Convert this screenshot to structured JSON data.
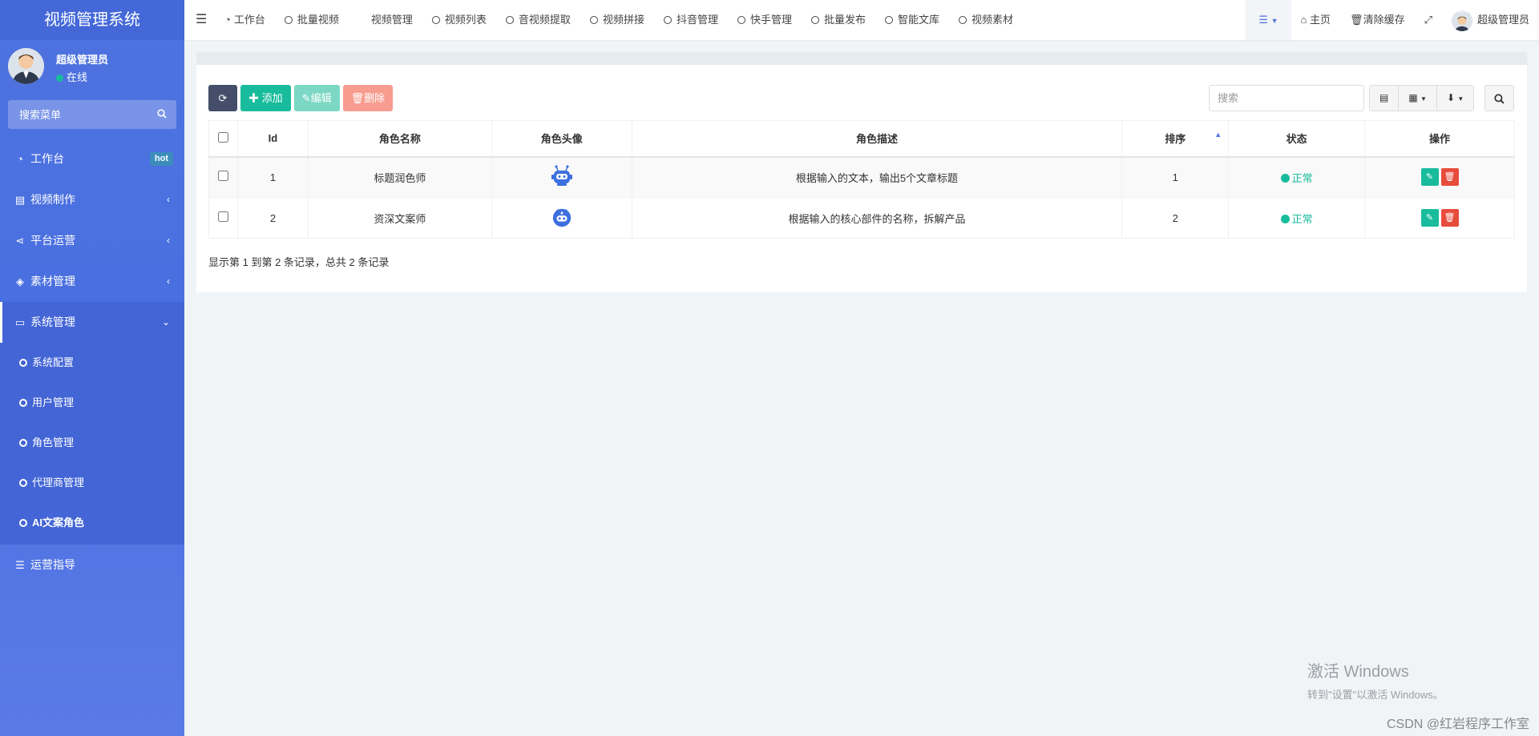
{
  "app": {
    "title": "视频管理系统"
  },
  "user": {
    "name": "超级管理员",
    "status": "在线"
  },
  "sidebar": {
    "search_placeholder": "搜索菜单",
    "items": [
      {
        "label": "工作台",
        "icon": "dashboard-icon",
        "badge": "hot"
      },
      {
        "label": "视频制作",
        "icon": "film-icon",
        "arrow": "‹"
      },
      {
        "label": "平台运营",
        "icon": "share-icon",
        "arrow": "‹"
      },
      {
        "label": "素材管理",
        "icon": "layers-icon",
        "arrow": "‹"
      },
      {
        "label": "系统管理",
        "icon": "desktop-icon",
        "arrow": "⌄"
      },
      {
        "label": "运营指导",
        "icon": "list-icon"
      }
    ],
    "sub_items": [
      {
        "label": "系统配置"
      },
      {
        "label": "用户管理"
      },
      {
        "label": "角色管理"
      },
      {
        "label": "代理商管理"
      },
      {
        "label": "AI文案角色"
      }
    ]
  },
  "navbar": {
    "tabs": [
      {
        "label": "工作台",
        "icon": "dashboard-icon"
      },
      {
        "label": "批量视频",
        "icon": "circle-icon"
      },
      {
        "label": "视频管理",
        "icon": ""
      },
      {
        "label": "视频列表",
        "icon": "circle-icon"
      },
      {
        "label": "音视频提取",
        "icon": "circle-icon"
      },
      {
        "label": "视频拼接",
        "icon": "circle-icon"
      },
      {
        "label": "抖音管理",
        "icon": "circle-icon"
      },
      {
        "label": "快手管理",
        "icon": "circle-icon"
      },
      {
        "label": "批量发布",
        "icon": "circle-icon"
      },
      {
        "label": "智能文库",
        "icon": "circle-icon"
      },
      {
        "label": "视频素材",
        "icon": "circle-icon"
      }
    ],
    "home": "主页",
    "clear_cache": "清除缓存",
    "user": "超级管理员"
  },
  "toolbar": {
    "add": "添加",
    "edit": "编辑",
    "delete": "删除",
    "search_placeholder": "搜索"
  },
  "table": {
    "columns": [
      "Id",
      "角色名称",
      "角色头像",
      "角色描述",
      "排序",
      "状态",
      "操作"
    ],
    "rows": [
      {
        "id": "1",
        "name": "标题润色师",
        "avatar": "robot-icon",
        "desc": "根据输入的文本，输出5个文章标题",
        "sort": "1",
        "status": "正常"
      },
      {
        "id": "2",
        "name": "资深文案师",
        "avatar": "robot-icon",
        "desc": "根据输入的核心部件的名称，拆解产品",
        "sort": "2",
        "status": "正常"
      }
    ]
  },
  "pager": {
    "info": "显示第 1 到第 2 条记录，总共 2 条记录"
  },
  "watermark": {
    "line1": "激活 Windows",
    "line2": "转到\"设置\"以激活 Windows。"
  },
  "credit": "CSDN @红岩程序工作室",
  "colors": {
    "sidebar": "#4e73df",
    "accent": "#18bc9c",
    "danger": "#e74c3c",
    "dark": "#444d69"
  }
}
